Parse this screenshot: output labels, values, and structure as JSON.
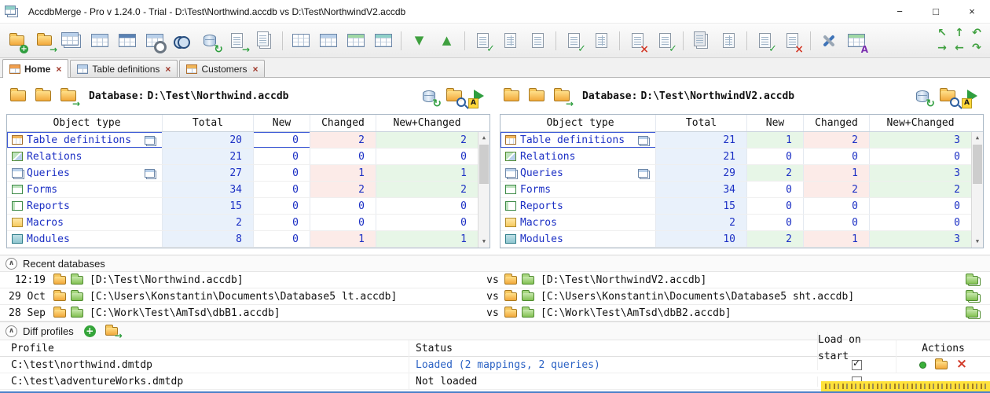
{
  "colors": {
    "text_blue": "#1b2fc4",
    "tint_total": "#e9f1fb",
    "tint_new": "#e7f6e7",
    "tint_changed": "#fcebe8",
    "selection_border": "#3f5bd6",
    "status_loaded": "#2b62c4",
    "folder_yellow": "#f2a93b",
    "icon_green": "#2f9e3f",
    "icon_red": "#d23b2a",
    "watermark_yellow": "#ffe23a"
  },
  "window": {
    "title": "AccdbMerge - Pro v 1.24.0 - Trial - D:\\Test\\Northwind.accdb vs D:\\Test\\NorthwindV2.accdb",
    "controls": {
      "minimize": "−",
      "maximize": "□",
      "close": "×"
    }
  },
  "toolbar": {
    "icons": [
      {
        "name": "new-database",
        "shape": "fold",
        "badge": "plus"
      },
      {
        "name": "open-database",
        "shape": "fold",
        "badge": "arrow"
      },
      {
        "name": "copy-tables",
        "shape": "grd dup"
      },
      {
        "name": "table",
        "shape": "grd"
      },
      {
        "name": "select-query",
        "shape": "grd hd-dark"
      },
      {
        "name": "form-design",
        "shape": "grd",
        "badge": "gear"
      },
      {
        "name": "search",
        "shape": "bino"
      },
      {
        "name": "refresh-databases",
        "shape": "cyl",
        "badge": "refresh"
      },
      {
        "name": "import-file",
        "shape": "pag",
        "badge": "arrow"
      },
      {
        "name": "copy",
        "shape": "pag dup"
      },
      {
        "sep": true
      },
      {
        "name": "grid-plain",
        "shape": "grd hd-none"
      },
      {
        "name": "grid-blue",
        "shape": "grd"
      },
      {
        "name": "grid-green",
        "shape": "grd hd-green"
      },
      {
        "name": "grid-teal",
        "shape": "grd hd-teal"
      },
      {
        "sep": true
      },
      {
        "name": "move-down",
        "glyph": "▼"
      },
      {
        "name": "move-up",
        "glyph": "▲"
      },
      {
        "sep": true
      },
      {
        "name": "report-check",
        "shape": "pag",
        "badge": "check"
      },
      {
        "name": "report-grid",
        "shape": "pag pg-grid"
      },
      {
        "name": "report-plain",
        "shape": "pag"
      },
      {
        "sep": true
      },
      {
        "name": "script-check",
        "shape": "pag",
        "badge": "check"
      },
      {
        "name": "script-grid",
        "shape": "pag pg-grid"
      },
      {
        "sep": true
      },
      {
        "name": "report-error",
        "shape": "pag",
        "badge": "x"
      },
      {
        "name": "report-ok",
        "shape": "pag",
        "badge": "check"
      },
      {
        "sep": true
      },
      {
        "name": "pages-gray",
        "shape": "pag dup gray"
      },
      {
        "name": "page-blue",
        "shape": "pag pg-grid"
      },
      {
        "sep": true
      },
      {
        "name": "doc-check",
        "shape": "pag",
        "badge": "check"
      },
      {
        "name": "doc-error",
        "shape": "pag",
        "badge": "x"
      },
      {
        "sep": true
      },
      {
        "name": "settings",
        "shape": "tools"
      },
      {
        "name": "font-table",
        "shape": "grd hd-green",
        "badge": "a"
      }
    ],
    "nav_arrows": [
      {
        "name": "nav-up-left",
        "glyph": "↖"
      },
      {
        "name": "nav-up",
        "glyph": "↑"
      },
      {
        "name": "nav-undo",
        "glyph": "↶"
      },
      {
        "name": "nav-right",
        "glyph": "→"
      },
      {
        "name": "nav-left",
        "glyph": "←"
      },
      {
        "name": "nav-redo",
        "glyph": "↷"
      }
    ]
  },
  "tabs": [
    {
      "label": "Home",
      "close": "×",
      "active": true
    },
    {
      "label": "Table definitions",
      "close": "×",
      "active": false
    },
    {
      "label": "Customers",
      "close": "×",
      "active": false
    }
  ],
  "panel_header_icons": {
    "left": [
      {
        "name": "open-database",
        "shape": "fold f20"
      },
      {
        "name": "open-folder",
        "shape": "fold f20"
      },
      {
        "name": "swap-databases",
        "shape": "fold f20",
        "badge": "arrow"
      }
    ],
    "right": [
      {
        "name": "refresh-database",
        "shape": "cyl",
        "badge": "refresh"
      },
      {
        "name": "search-objects",
        "shape": "fold f20",
        "badge": "mag"
      },
      {
        "name": "run-compare",
        "shape": "play",
        "badge": "a-yellow"
      }
    ]
  },
  "panels": [
    {
      "db_label": "Database:",
      "db_path": "D:\\Test\\Northwind.accdb",
      "table": {
        "headers": [
          "Object type",
          "Total",
          "New",
          "Changed",
          "New+Changed"
        ],
        "rows": [
          {
            "icon": "tables",
            "label": "Table definitions",
            "total": 20,
            "new": 0,
            "changed": 2,
            "new_changed": 2,
            "selected": true,
            "copy": true
          },
          {
            "icon": "relations",
            "label": "Relations",
            "total": 21,
            "new": 0,
            "changed": 0,
            "new_changed": 0
          },
          {
            "icon": "queries",
            "label": "Queries",
            "total": 27,
            "new": 0,
            "changed": 1,
            "new_changed": 1,
            "copy": true
          },
          {
            "icon": "forms",
            "label": "Forms",
            "total": 34,
            "new": 0,
            "changed": 2,
            "new_changed": 2
          },
          {
            "icon": "reports",
            "label": "Reports",
            "total": 15,
            "new": 0,
            "changed": 0,
            "new_changed": 0
          },
          {
            "icon": "macros",
            "label": "Macros",
            "total": 2,
            "new": 0,
            "changed": 0,
            "new_changed": 0
          },
          {
            "icon": "modules",
            "label": "Modules",
            "total": 8,
            "new": 0,
            "changed": 1,
            "new_changed": 1
          }
        ]
      }
    },
    {
      "db_label": "Database:",
      "db_path": "D:\\Test\\NorthwindV2.accdb",
      "table": {
        "headers": [
          "Object type",
          "Total",
          "New",
          "Changed",
          "New+Changed"
        ],
        "rows": [
          {
            "icon": "tables",
            "label": "Table definitions",
            "total": 21,
            "new": 1,
            "changed": 2,
            "new_changed": 3,
            "selected": true,
            "copy": true
          },
          {
            "icon": "relations",
            "label": "Relations",
            "total": 21,
            "new": 0,
            "changed": 0,
            "new_changed": 0
          },
          {
            "icon": "queries",
            "label": "Queries",
            "total": 29,
            "new": 2,
            "changed": 1,
            "new_changed": 3,
            "copy": true
          },
          {
            "icon": "forms",
            "label": "Forms",
            "total": 34,
            "new": 0,
            "changed": 2,
            "new_changed": 2
          },
          {
            "icon": "reports",
            "label": "Reports",
            "total": 15,
            "new": 0,
            "changed": 0,
            "new_changed": 0
          },
          {
            "icon": "macros",
            "label": "Macros",
            "total": 2,
            "new": 0,
            "changed": 0,
            "new_changed": 0
          },
          {
            "icon": "modules",
            "label": "Modules",
            "total": 10,
            "new": 2,
            "changed": 1,
            "new_changed": 3
          }
        ]
      }
    }
  ],
  "recent": {
    "title": "Recent databases",
    "vs_label": "vs",
    "rows": [
      {
        "time": "12:19",
        "left_path": "[D:\\Test\\Northwind.accdb]",
        "right_path": "[D:\\Test\\NorthwindV2.accdb]"
      },
      {
        "time": "29 Oct",
        "left_path": "[C:\\Users\\Konstantin\\Documents\\Database5 lt.accdb]",
        "right_path": "[C:\\Users\\Konstantin\\Documents\\Database5 sht.accdb]"
      },
      {
        "time": "28 Sep",
        "left_path": "[C:\\Work\\Test\\AmTsd\\dbB1.accdb]",
        "right_path": "[C:\\Work\\Test\\AmTsd\\dbB2.accdb]"
      }
    ]
  },
  "profiles": {
    "title": "Diff profiles",
    "headers": [
      "Profile",
      "Status",
      "Load on start",
      "Actions"
    ],
    "rows": [
      {
        "profile": "C:\\test\\northwind.dmtdp",
        "status": "Loaded (2 mappings, 2 queries)",
        "loaded": true,
        "load_on_start": true,
        "show_actions": true
      },
      {
        "profile": "C:\\test\\adventureWorks.dmtdp",
        "status": "Not loaded",
        "loaded": false,
        "load_on_start": false,
        "show_actions": false
      }
    ]
  }
}
